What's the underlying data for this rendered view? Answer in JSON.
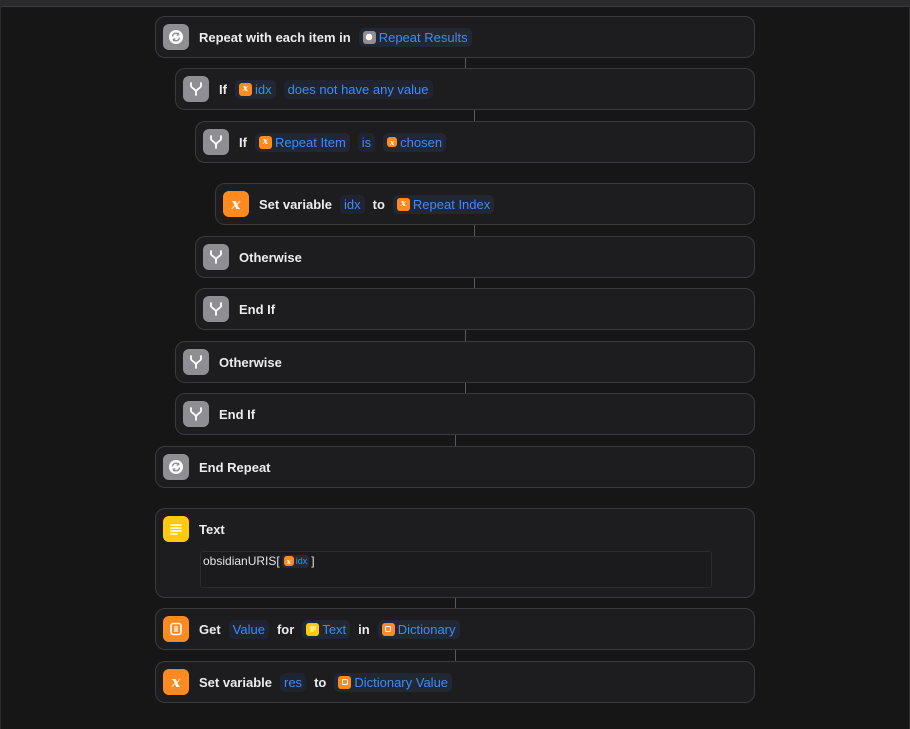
{
  "colors": {
    "background": "#161617",
    "card": "#1d1d1f",
    "token_blue": "#3d8bff",
    "icon_gray": "#8e8e93",
    "icon_orange": "#ff8a1f",
    "icon_yellow": "#ffca0a"
  },
  "actions": {
    "repeat": {
      "keyword": "Repeat with each item in",
      "input": "Repeat Results",
      "icon": "repeat-icon"
    },
    "if1": {
      "keyword": "If",
      "variable": "idx",
      "condition": "does not have any value",
      "icon": "branch-icon"
    },
    "if2": {
      "keyword": "If",
      "variable": "Repeat Item",
      "operator": "is",
      "value": "chosen",
      "icon": "branch-icon"
    },
    "setvar1": {
      "keyword": "Set variable",
      "variable": "idx",
      "to": "to",
      "value": "Repeat Index",
      "icon": "variable-icon"
    },
    "otherwise2": {
      "keyword": "Otherwise",
      "icon": "branch-icon"
    },
    "endif2": {
      "keyword": "End If",
      "icon": "branch-icon"
    },
    "otherwise1": {
      "keyword": "Otherwise",
      "icon": "branch-icon"
    },
    "endif1": {
      "keyword": "End If",
      "icon": "branch-icon"
    },
    "endrepeat": {
      "keyword": "End Repeat",
      "icon": "repeat-icon"
    },
    "text": {
      "keyword": "Text",
      "content_prefix": "obsidianURIS[",
      "content_var": "idx",
      "content_suffix": "]",
      "icon": "text-lines-icon"
    },
    "getvalue": {
      "keyword": "Get",
      "key": "Value",
      "for": "for",
      "text_var": "Text",
      "in": "in",
      "dict": "Dictionary",
      "icon": "dictionary-icon"
    },
    "setvar2": {
      "keyword": "Set variable",
      "variable": "res",
      "to": "to",
      "value": "Dictionary Value",
      "icon": "variable-icon"
    }
  }
}
